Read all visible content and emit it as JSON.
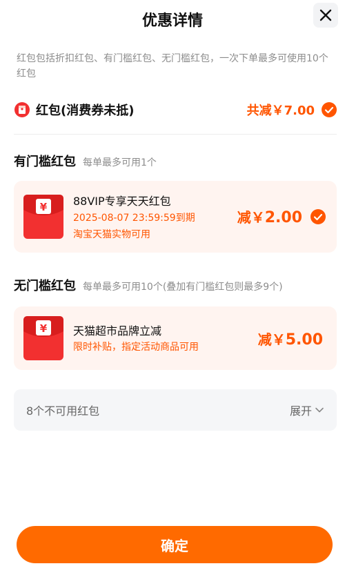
{
  "header": {
    "title": "优惠详情",
    "close_icon": "close-icon"
  },
  "description": "红包包括折扣红包、有门槛红包、无门槛红包，一次下单最多可使用10个红包",
  "summary": {
    "label": "红包(消费券未抵)",
    "total": "共减￥7.00",
    "selected": true
  },
  "sections": [
    {
      "title": "有门槛红包",
      "subtitle": "每单最多可用1个",
      "cards": [
        {
          "name": "88VIP专享天天红包",
          "line2": "2025-08-07 23:59:59到期",
          "line3": "淘宝天猫实物可用",
          "amount_prefix": "减",
          "amount_currency": "￥",
          "amount_value": "2.00",
          "selected": true
        }
      ]
    },
    {
      "title": "无门槛红包",
      "subtitle": "每单最多可用10个(叠加有门槛红包则最多9个)",
      "cards": [
        {
          "name": "天猫超市品牌立减",
          "line2": "限时补贴，指定活动商品可用",
          "amount_prefix": "减",
          "amount_currency": "￥",
          "amount_value": "5.00",
          "selected": false
        }
      ]
    }
  ],
  "unavailable": {
    "label": "8个不可用红包",
    "expand_label": "展开"
  },
  "confirm_label": "确定",
  "colors": {
    "accent": "#ff5500",
    "button": "#ff6a00",
    "card_bg": "#fff4f0",
    "envelope": "#f23030"
  }
}
